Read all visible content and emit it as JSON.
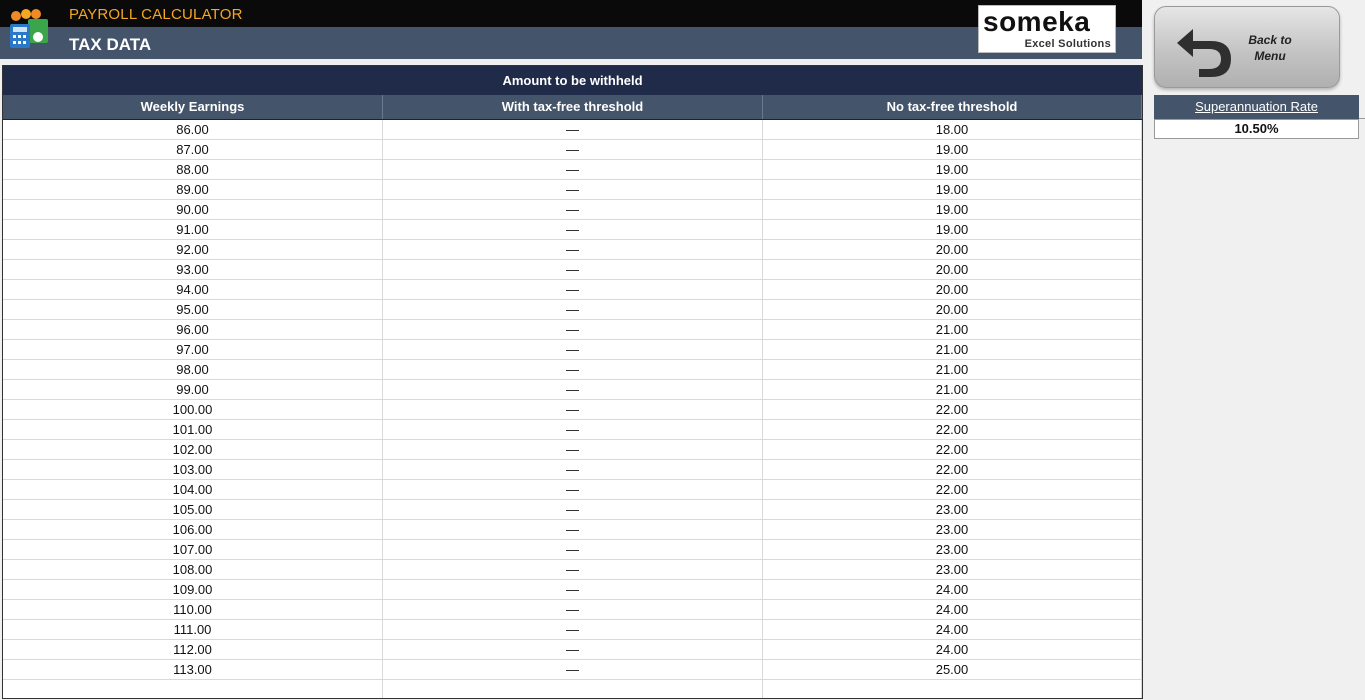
{
  "header": {
    "app_title": "PAYROLL CALCULATOR",
    "page_title": "TAX DATA",
    "brand_name": "someka",
    "brand_sub": "Excel Solutions",
    "accent": "#f5a623",
    "dark_bar": "#0a0a0a",
    "slate_bar": "#44546a"
  },
  "nav": {
    "back_label_1": "Back to",
    "back_label_2": "Menu"
  },
  "table": {
    "band_title": "Amount to be withheld",
    "columns": [
      "Weekly Earnings",
      "With tax-free threshold",
      "No tax-free threshold"
    ],
    "rows": [
      [
        "86.00",
        "—",
        "18.00"
      ],
      [
        "87.00",
        "—",
        "19.00"
      ],
      [
        "88.00",
        "—",
        "19.00"
      ],
      [
        "89.00",
        "—",
        "19.00"
      ],
      [
        "90.00",
        "—",
        "19.00"
      ],
      [
        "91.00",
        "—",
        "19.00"
      ],
      [
        "92.00",
        "—",
        "20.00"
      ],
      [
        "93.00",
        "—",
        "20.00"
      ],
      [
        "94.00",
        "—",
        "20.00"
      ],
      [
        "95.00",
        "—",
        "20.00"
      ],
      [
        "96.00",
        "—",
        "21.00"
      ],
      [
        "97.00",
        "—",
        "21.00"
      ],
      [
        "98.00",
        "—",
        "21.00"
      ],
      [
        "99.00",
        "—",
        "21.00"
      ],
      [
        "100.00",
        "—",
        "22.00"
      ],
      [
        "101.00",
        "—",
        "22.00"
      ],
      [
        "102.00",
        "—",
        "22.00"
      ],
      [
        "103.00",
        "—",
        "22.00"
      ],
      [
        "104.00",
        "—",
        "22.00"
      ],
      [
        "105.00",
        "—",
        "23.00"
      ],
      [
        "106.00",
        "—",
        "23.00"
      ],
      [
        "107.00",
        "—",
        "23.00"
      ],
      [
        "108.00",
        "—",
        "23.00"
      ],
      [
        "109.00",
        "—",
        "24.00"
      ],
      [
        "110.00",
        "—",
        "24.00"
      ],
      [
        "111.00",
        "—",
        "24.00"
      ],
      [
        "112.00",
        "—",
        "24.00"
      ],
      [
        "113.00",
        "—",
        "25.00"
      ],
      [
        "",
        "",
        ""
      ]
    ]
  },
  "super": {
    "label": "Superannuation Rate",
    "value": "10.50%"
  }
}
